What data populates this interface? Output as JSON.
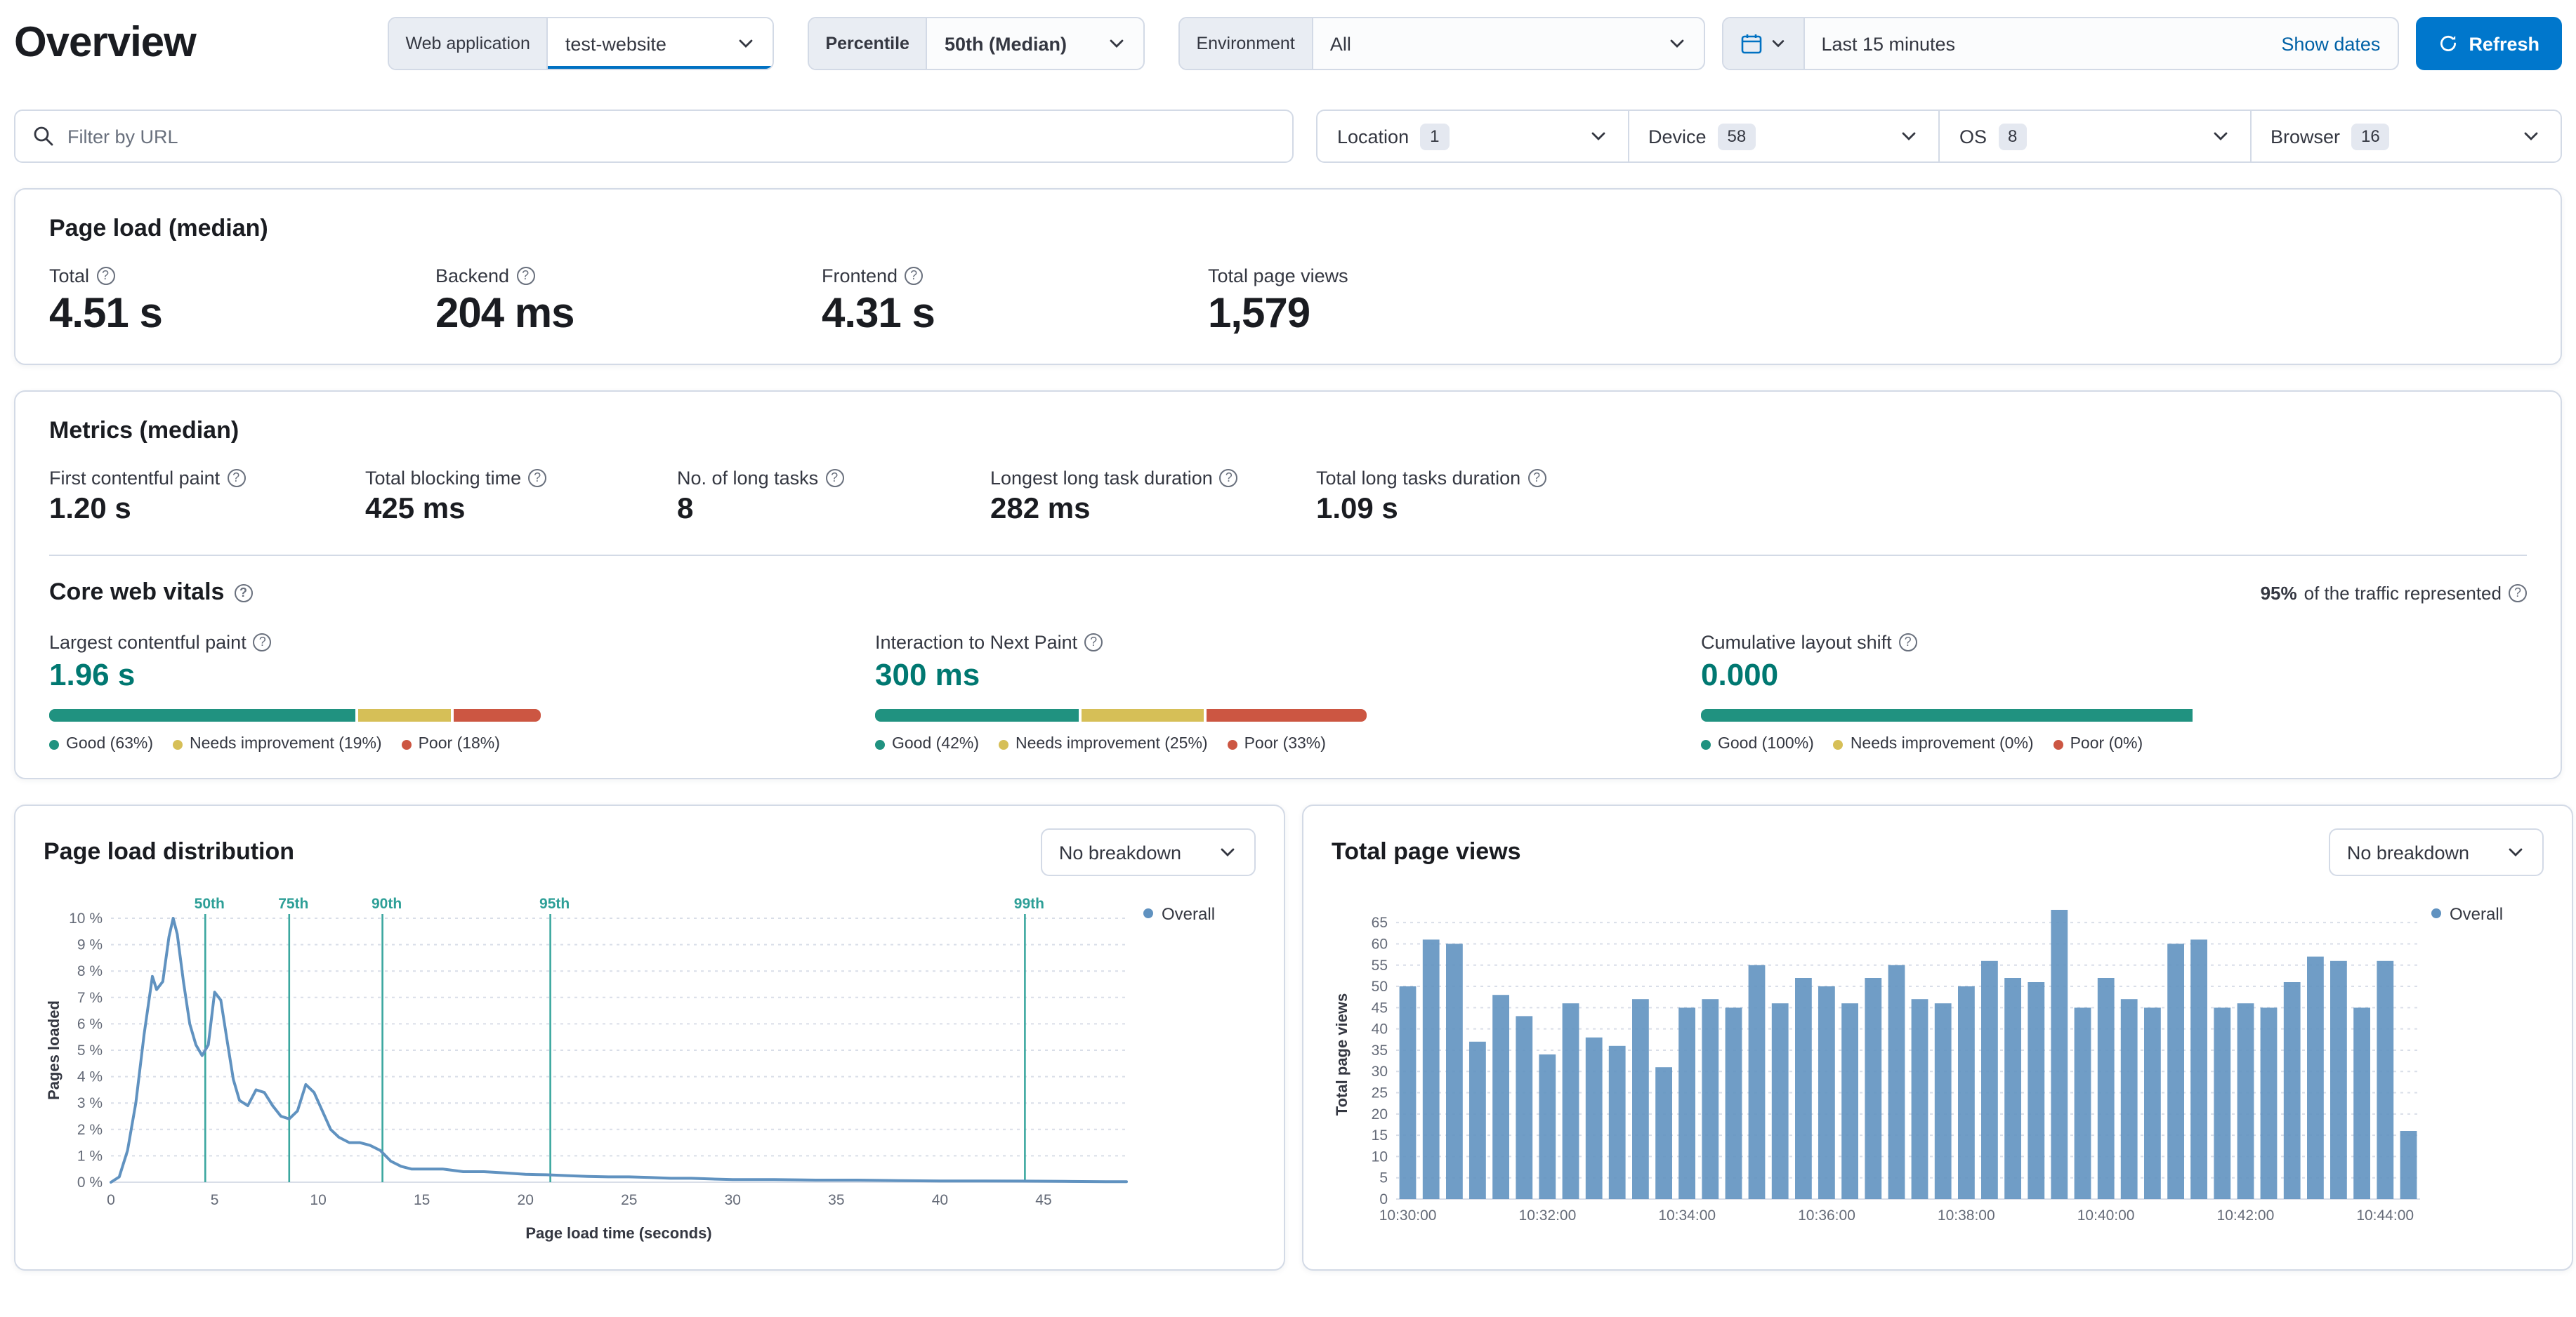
{
  "colors": {
    "accent_blue": "#0077cc",
    "series_blue": "#6092c0",
    "vital_value": "#007871",
    "good": "#209280",
    "needs_improvement": "#d6bf57",
    "poor": "#cc5642",
    "percentile_marker": "#3ba79f",
    "badge_bg": "#e4e8f0"
  },
  "header": {
    "title": "Overview",
    "web_application": {
      "label": "Web application",
      "value": "test-website"
    },
    "percentile": {
      "label": "Percentile",
      "value": "50th (Median)"
    },
    "environment": {
      "label": "Environment",
      "value": "All"
    },
    "time_picker": {
      "value": "Last 15 minutes",
      "show_dates_label": "Show dates"
    },
    "refresh_label": "Refresh"
  },
  "filter_bar": {
    "search_placeholder": "Filter by URL",
    "filters": [
      {
        "label": "Location",
        "count": "1"
      },
      {
        "label": "Device",
        "count": "58"
      },
      {
        "label": "OS",
        "count": "8"
      },
      {
        "label": "Browser",
        "count": "16"
      }
    ]
  },
  "page_load_panel": {
    "title": "Page load (median)",
    "stats": [
      {
        "label": "Total",
        "value": "4.51 s"
      },
      {
        "label": "Backend",
        "value": "204 ms"
      },
      {
        "label": "Frontend",
        "value": "4.31 s"
      },
      {
        "label": "Total page views",
        "value": "1,579"
      }
    ]
  },
  "metrics_panel": {
    "title": "Metrics (median)",
    "stats": [
      {
        "label": "First contentful paint",
        "value": "1.20 s"
      },
      {
        "label": "Total blocking time",
        "value": "425 ms"
      },
      {
        "label": "No. of long tasks",
        "value": "8"
      },
      {
        "label": "Longest long task duration",
        "value": "282 ms"
      },
      {
        "label": "Total long tasks duration",
        "value": "1.09 s"
      }
    ],
    "core_web_vitals": {
      "title": "Core web vitals",
      "traffic_percent": "95%",
      "traffic_text": "of the traffic represented",
      "vitals": [
        {
          "label": "Largest contentful paint",
          "value": "1.96 s",
          "segments": {
            "good": 63,
            "needs_improvement": 19,
            "poor": 18
          },
          "legend": {
            "good": "Good (63%)",
            "needs_improvement": "Needs improvement (19%)",
            "poor": "Poor (18%)"
          }
        },
        {
          "label": "Interaction to Next Paint",
          "value": "300 ms",
          "segments": {
            "good": 42,
            "needs_improvement": 25,
            "poor": 33
          },
          "legend": {
            "good": "Good (42%)",
            "needs_improvement": "Needs improvement (25%)",
            "poor": "Poor (33%)"
          }
        },
        {
          "label": "Cumulative layout shift",
          "value": "0.000",
          "segments": {
            "good": 100,
            "needs_improvement": 0,
            "poor": 0
          },
          "legend": {
            "good": "Good (100%)",
            "needs_improvement": "Needs improvement (0%)",
            "poor": "Poor (0%)"
          }
        }
      ]
    }
  },
  "distribution_panel": {
    "title": "Page load distribution",
    "breakdown_value": "No breakdown",
    "legend": "Overall"
  },
  "page_views_panel": {
    "title": "Total page views",
    "breakdown_value": "No breakdown",
    "legend": "Overall"
  },
  "chart_data": [
    {
      "type": "line",
      "title": "Page load distribution",
      "xlabel": "Page load time (seconds)",
      "ylabel": "Pages loaded",
      "xlim": [
        0,
        49
      ],
      "ylim": [
        0,
        10
      ],
      "x_ticks": [
        0,
        5,
        10,
        15,
        20,
        25,
        30,
        35,
        40,
        45
      ],
      "y_tick_labels": [
        "0 %",
        "1 %",
        "2 %",
        "3 %",
        "4 %",
        "5 %",
        "6 %",
        "7 %",
        "8 %",
        "9 %",
        "10 %"
      ],
      "grid": true,
      "legend_position": "right",
      "percentile_markers": [
        {
          "label": "50th",
          "x": 4.55
        },
        {
          "label": "75th",
          "x": 8.6
        },
        {
          "label": "90th",
          "x": 13.1
        },
        {
          "label": "95th",
          "x": 21.2
        },
        {
          "label": "99th",
          "x": 44.1
        }
      ],
      "series": [
        {
          "name": "Overall",
          "points": [
            [
              0,
              0
            ],
            [
              0.4,
              0.2
            ],
            [
              0.8,
              1.2
            ],
            [
              1.2,
              3.0
            ],
            [
              1.6,
              5.6
            ],
            [
              2.0,
              7.8
            ],
            [
              2.2,
              7.3
            ],
            [
              2.5,
              7.6
            ],
            [
              2.8,
              9.3
            ],
            [
              3.0,
              10.0
            ],
            [
              3.2,
              9.4
            ],
            [
              3.5,
              7.6
            ],
            [
              3.8,
              6.0
            ],
            [
              4.1,
              5.2
            ],
            [
              4.4,
              4.8
            ],
            [
              4.7,
              5.2
            ],
            [
              5.0,
              7.2
            ],
            [
              5.3,
              6.9
            ],
            [
              5.6,
              5.4
            ],
            [
              5.9,
              3.9
            ],
            [
              6.2,
              3.1
            ],
            [
              6.6,
              2.9
            ],
            [
              7.0,
              3.5
            ],
            [
              7.4,
              3.4
            ],
            [
              7.8,
              2.9
            ],
            [
              8.2,
              2.5
            ],
            [
              8.6,
              2.4
            ],
            [
              9.0,
              2.7
            ],
            [
              9.4,
              3.7
            ],
            [
              9.8,
              3.4
            ],
            [
              10.2,
              2.7
            ],
            [
              10.6,
              2.0
            ],
            [
              11.0,
              1.7
            ],
            [
              11.5,
              1.5
            ],
            [
              12.0,
              1.5
            ],
            [
              12.5,
              1.4
            ],
            [
              13.0,
              1.2
            ],
            [
              13.5,
              0.8
            ],
            [
              14.0,
              0.6
            ],
            [
              14.5,
              0.5
            ],
            [
              15.0,
              0.5
            ],
            [
              16.0,
              0.5
            ],
            [
              17.0,
              0.4
            ],
            [
              18.0,
              0.4
            ],
            [
              19.0,
              0.35
            ],
            [
              20.0,
              0.3
            ],
            [
              21.0,
              0.28
            ],
            [
              22.0,
              0.25
            ],
            [
              23.0,
              0.22
            ],
            [
              24.0,
              0.2
            ],
            [
              25.0,
              0.2
            ],
            [
              26.0,
              0.18
            ],
            [
              27.0,
              0.15
            ],
            [
              28.0,
              0.15
            ],
            [
              29.0,
              0.12
            ],
            [
              30.0,
              0.1
            ],
            [
              32.0,
              0.1
            ],
            [
              34.0,
              0.08
            ],
            [
              36.0,
              0.08
            ],
            [
              38.0,
              0.06
            ],
            [
              40.0,
              0.05
            ],
            [
              42.0,
              0.05
            ],
            [
              44.0,
              0.04
            ],
            [
              46.0,
              0.03
            ],
            [
              48.0,
              0.02
            ],
            [
              49.0,
              0.02
            ]
          ]
        }
      ]
    },
    {
      "type": "bar",
      "title": "Total page views",
      "xlabel": "",
      "ylabel": "Total page views",
      "ylim": [
        0,
        68
      ],
      "y_ticks": [
        0,
        5,
        10,
        15,
        20,
        25,
        30,
        35,
        40,
        45,
        50,
        55,
        60,
        65
      ],
      "grid": true,
      "legend_position": "right",
      "x_tick_labels": [
        "10:30:00",
        "10:32:00",
        "10:34:00",
        "10:36:00",
        "10:38:00",
        "10:40:00",
        "10:42:00",
        "10:44:00"
      ],
      "x_tick_every": 6,
      "series": [
        {
          "name": "Overall",
          "values": [
            50,
            61,
            60,
            37,
            48,
            43,
            34,
            46,
            38,
            36,
            47,
            31,
            45,
            47,
            45,
            55,
            46,
            52,
            50,
            46,
            52,
            55,
            47,
            46,
            50,
            56,
            52,
            51,
            68,
            45,
            52,
            47,
            45,
            60,
            61,
            45,
            46,
            45,
            51,
            57,
            56,
            45,
            56,
            16
          ]
        }
      ]
    }
  ]
}
